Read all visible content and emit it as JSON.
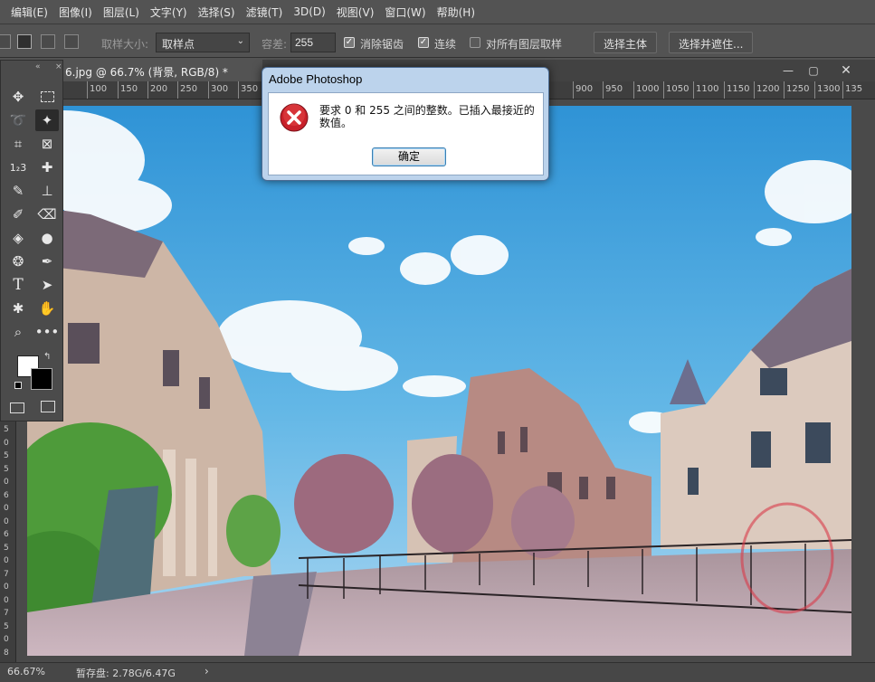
{
  "menubar": {
    "items": [
      "编辑(E)",
      "图像(I)",
      "图层(L)",
      "文字(Y)",
      "选择(S)",
      "滤镜(T)",
      "3D(D)",
      "视图(V)",
      "窗口(W)",
      "帮助(H)"
    ]
  },
  "options": {
    "sample_size_label": "取样大小:",
    "sample_size_value": "取样点",
    "tolerance_label": "容差:",
    "tolerance_value": "255",
    "antialias_label": "消除锯齿",
    "antialias_checked": true,
    "contiguous_label": "连续",
    "contiguous_checked": true,
    "all_layers_label": "对所有图层取样",
    "all_layers_checked": false,
    "select_subject_label": "选择主体",
    "select_mask_label": "选择并遮住..."
  },
  "document": {
    "tab_title": "6.jpg @ 66.7% (背景, RGB/8) *",
    "minimize_icon": "minimize-icon",
    "restore_icon": "restore-icon",
    "close_icon": "close-icon"
  },
  "ruler": {
    "h_ticks": [
      "100",
      "150",
      "200",
      "250",
      "300",
      "350",
      "900",
      "950",
      "1000",
      "1050",
      "1100",
      "1150",
      "1200",
      "1250",
      "1300",
      "135"
    ],
    "v_ticks": [
      "5",
      "0",
      "5",
      "5",
      "0",
      "6",
      "0",
      "0",
      "6",
      "5",
      "0",
      "7",
      "0",
      "0",
      "7",
      "5",
      "0",
      "8"
    ]
  },
  "toolbar": {
    "tools": [
      "move-icon",
      "marquee-icon",
      "lasso-icon",
      "magic-wand-icon",
      "crop-icon",
      "frame-icon",
      "eyedropper-icon",
      "healing-brush-icon",
      "brush-icon",
      "clone-stamp-icon",
      "history-brush-icon",
      "eraser-icon",
      "paint-bucket-icon",
      "blur-icon",
      "dodge-icon",
      "pen-icon",
      "type-icon",
      "path-select-icon",
      "shape-icon",
      "hand-icon",
      "zoom-icon",
      "more-icon"
    ],
    "type_glyph": "T"
  },
  "status": {
    "zoom": "66.67%",
    "scratch": "暂存盘: 2.78G/6.47G",
    "arrow": "›"
  },
  "dialog": {
    "title": "Adobe Photoshop",
    "message": "要求 0 和 255 之间的整数。已插入最接近的数值。",
    "ok_label": "确定",
    "icon": "error-icon"
  },
  "colors": {
    "ui_bg": "#535353",
    "sky": "#4aa6dc",
    "dialog_frame": "#bcd3ec",
    "error_red": "#d42a2a"
  }
}
